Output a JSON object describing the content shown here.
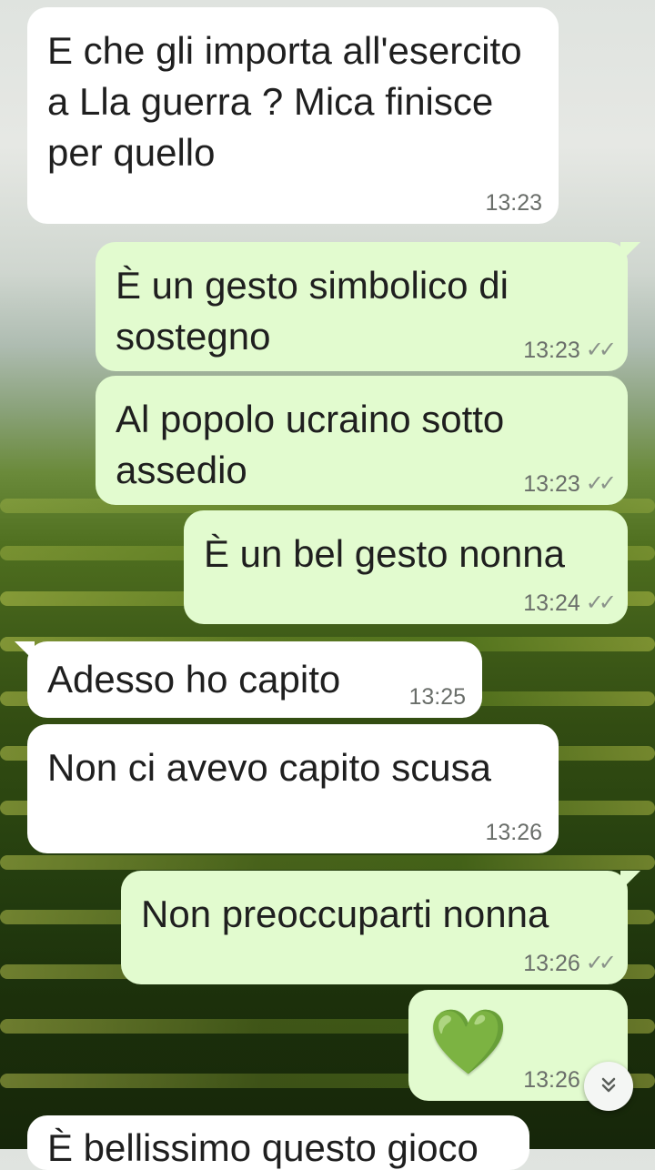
{
  "messages": [
    {
      "id": "m1",
      "direction": "in",
      "text": "E che gli importa all'esercito a Lla guerra ? Mica finisce per quello",
      "time": "13:23"
    },
    {
      "id": "m2",
      "direction": "out",
      "text": "È un gesto simbolico di sostegno",
      "time": "13:23"
    },
    {
      "id": "m3",
      "direction": "out",
      "text": "Al popolo ucraino sotto assedio",
      "time": "13:23"
    },
    {
      "id": "m4",
      "direction": "out",
      "text": "È un bel gesto nonna",
      "time": "13:24"
    },
    {
      "id": "m5",
      "direction": "in",
      "text": "Adesso ho capito",
      "time": "13:25"
    },
    {
      "id": "m6",
      "direction": "in",
      "text": "Non ci avevo capito scusa",
      "time": "13:26"
    },
    {
      "id": "m7",
      "direction": "out",
      "text": "Non preoccuparti nonna",
      "time": "13:26"
    },
    {
      "id": "m8",
      "direction": "out",
      "text": "💚",
      "time": "13:26"
    }
  ],
  "partial_message": {
    "text": "È bellissimo questo gioco off"
  },
  "icons": {
    "read_receipt": "double-check-icon",
    "scroll_down": "chevron-double-down-icon"
  },
  "colors": {
    "incoming_bubble": "#ffffff",
    "outgoing_bubble": "#e2fbcf",
    "heart": "#1fa62b"
  }
}
